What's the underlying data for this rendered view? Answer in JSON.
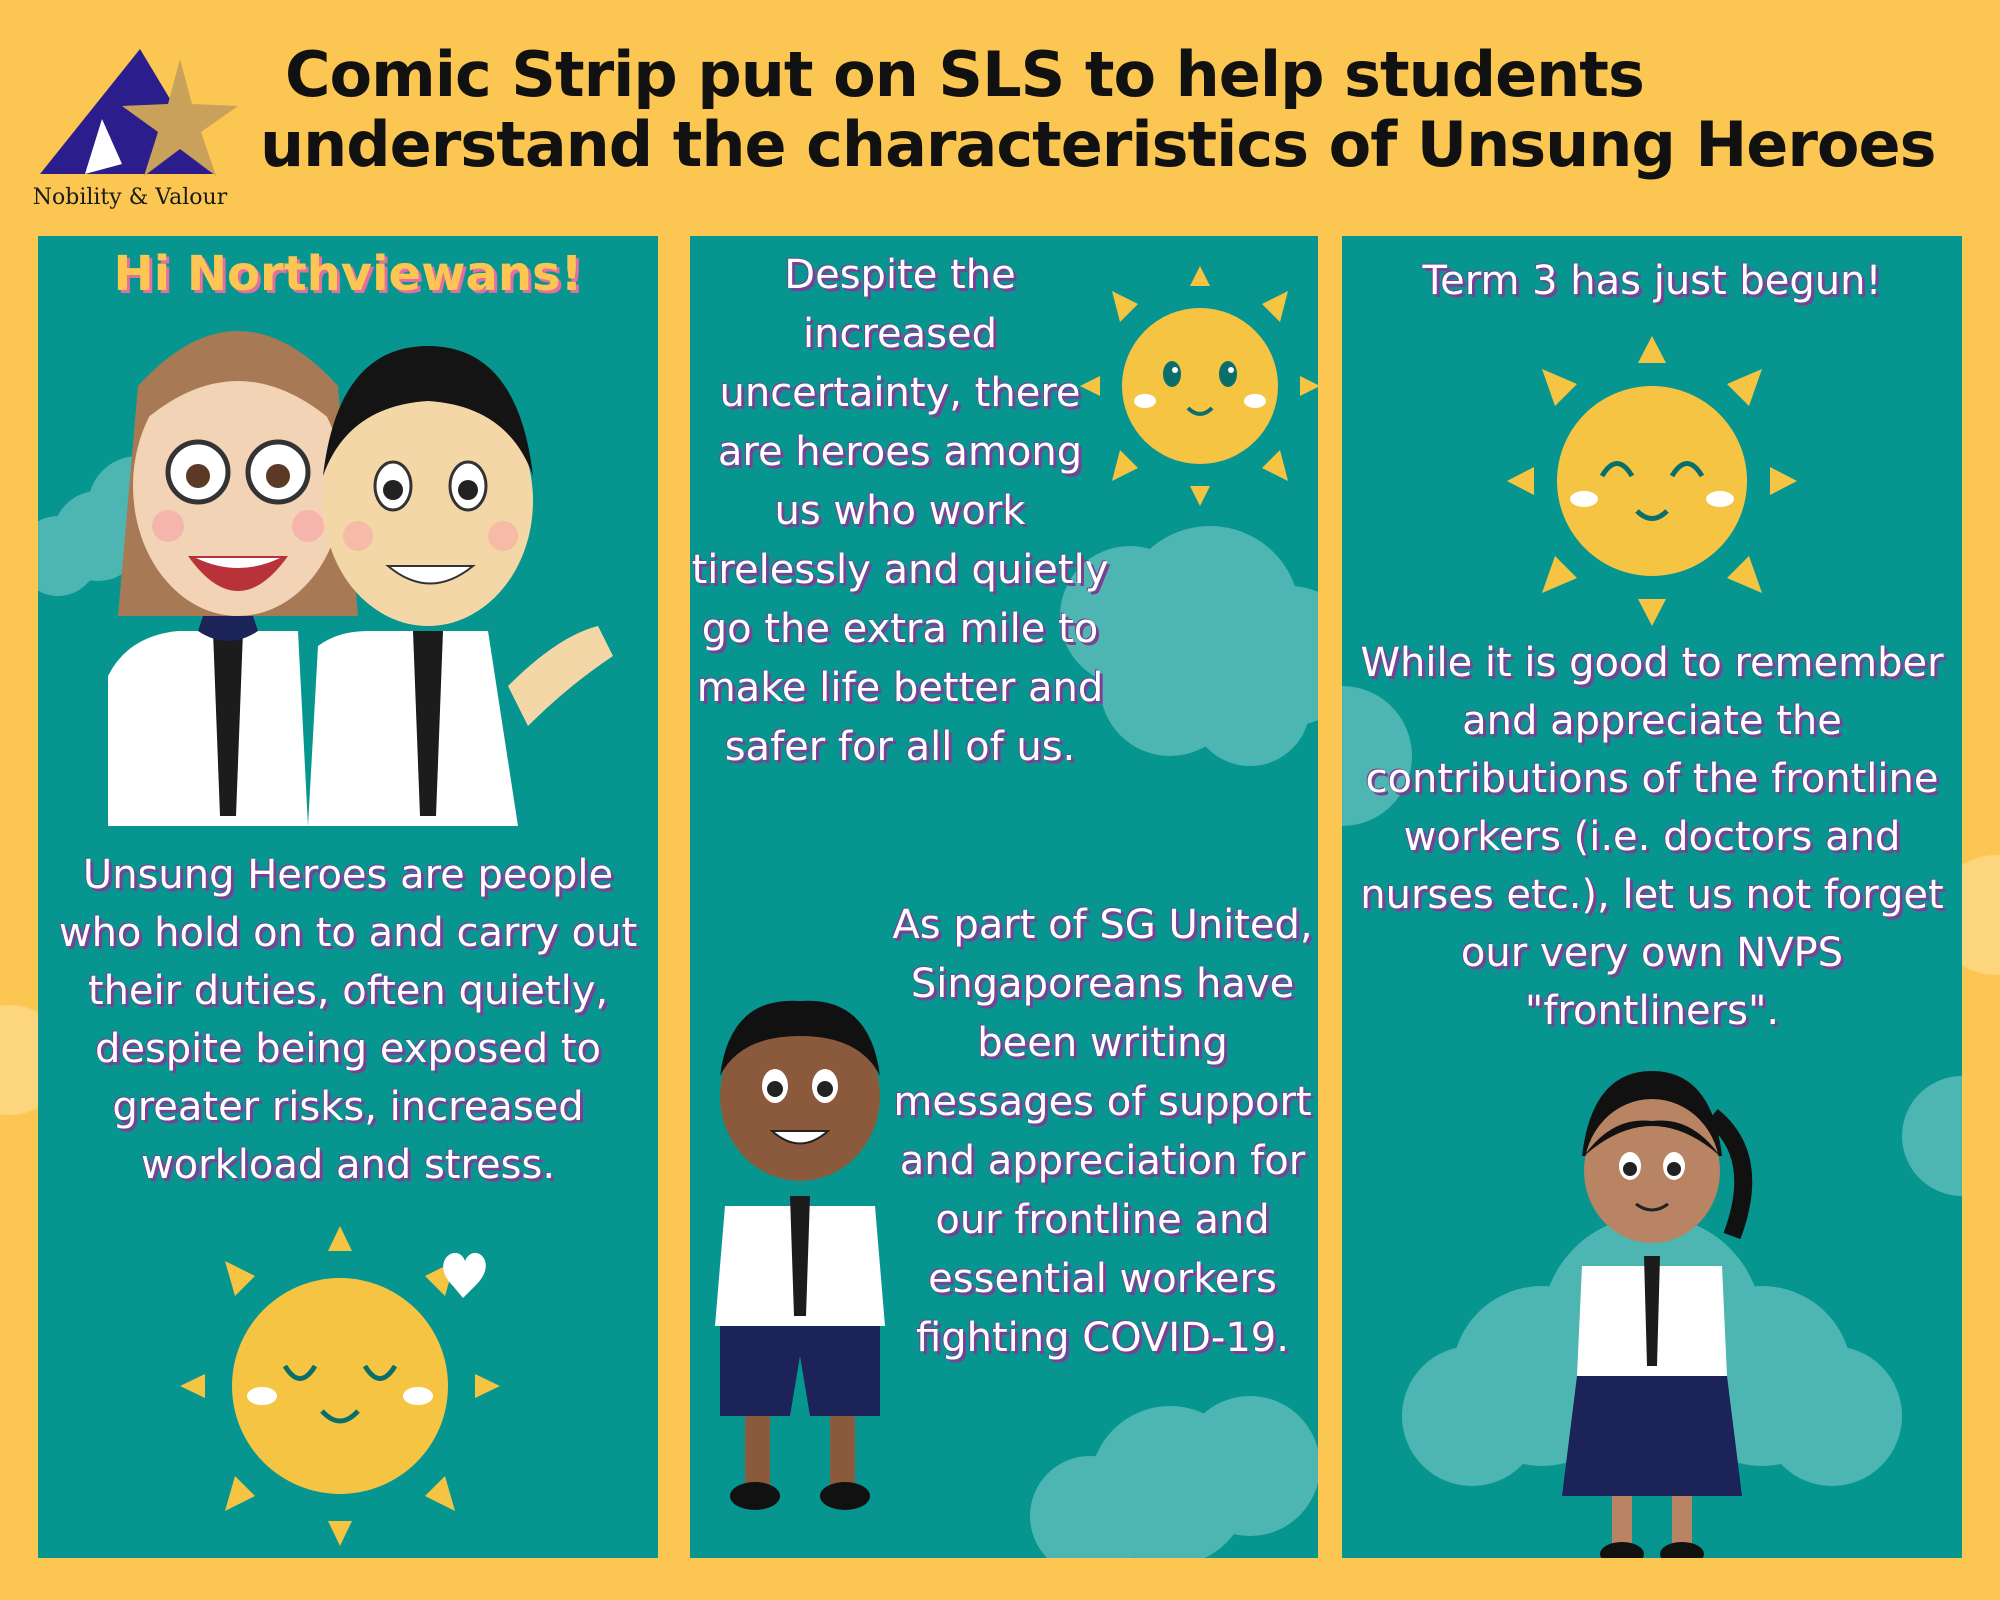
{
  "header": {
    "logo_caption": "Nobility & Valour",
    "title_line1": "Comic Strip put on SLS to help students",
    "title_line2": "understand the characteristics of Unsung Heroes"
  },
  "panel1": {
    "greeting": "Hi Northviewans!",
    "body": "Unsung Heroes are people who hold on to and carry out their duties, often quietly, despite being exposed to greater risks, increased workload and stress."
  },
  "panel2": {
    "text_top": "Despite the increased uncertainty, there are heroes among us who work tirelessly and quietly go the extra mile to make life better and safer for all of us.",
    "text_bottom": "As part of SG United, Singaporeans have been writing messages of support and appreciation for our frontline and essential workers fighting COVID-19."
  },
  "panel3": {
    "text_top": "Term 3 has just begun!",
    "text_bottom": "While it is good to remember and appreciate the contributions of the frontline workers (i.e. doctors and nurses etc.), let us not forget our very own NVPS \"frontliners\"."
  },
  "colors": {
    "background": "#FBC752",
    "panel": "#079590",
    "sun": "#F6C443",
    "text_shadow": "#7b3f96",
    "logo_blue": "#2B1E8C",
    "logo_gold": "#C9A15B"
  },
  "icons": [
    "logo-star-icon",
    "sun-icon",
    "heart-speech-icon",
    "cloud-icon"
  ]
}
